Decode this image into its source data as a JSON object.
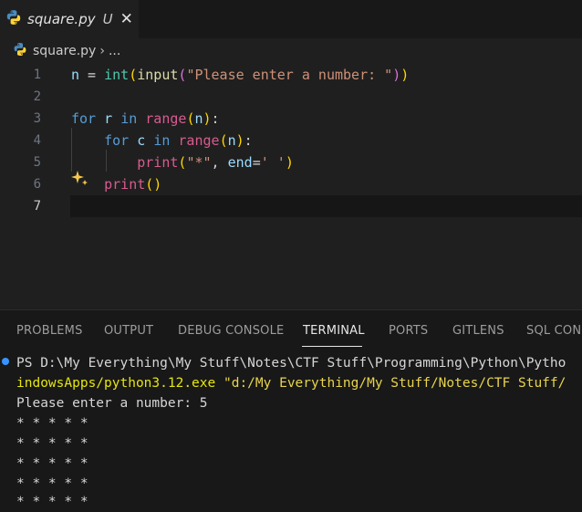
{
  "tab": {
    "filename": "square.py",
    "modified_marker": "U",
    "close": "✕"
  },
  "breadcrumb": {
    "file": "square.py",
    "separator": "›",
    "more": "..."
  },
  "editor": {
    "line_numbers": [
      "1",
      "2",
      "3",
      "4",
      "5",
      "6",
      "7"
    ],
    "active_line": "7"
  },
  "panel": {
    "tabs": [
      "PROBLEMS",
      "OUTPUT",
      "DEBUG CONSOLE",
      "TERMINAL",
      "PORTS",
      "GITLENS",
      "SQL CONS"
    ],
    "active_tab": "TERMINAL"
  },
  "terminal": {
    "line1": "PS D:\\My Everything\\My Stuff\\Notes\\CTF Stuff\\Programming\\Python\\Pytho",
    "line2_path": "indowsApps/python3.12.exe",
    "line2_arg": "\"d:/My Everything/My Stuff/Notes/CTF Stuff/",
    "prompt": "Please enter a number: 5",
    "output": [
      "* * * * *",
      "* * * * *",
      "* * * * *",
      "* * * * *",
      "* * * * *"
    ]
  },
  "colors": {
    "accent": "#3794ff",
    "background": "#1f1f1f",
    "panel_bg": "#181818"
  }
}
